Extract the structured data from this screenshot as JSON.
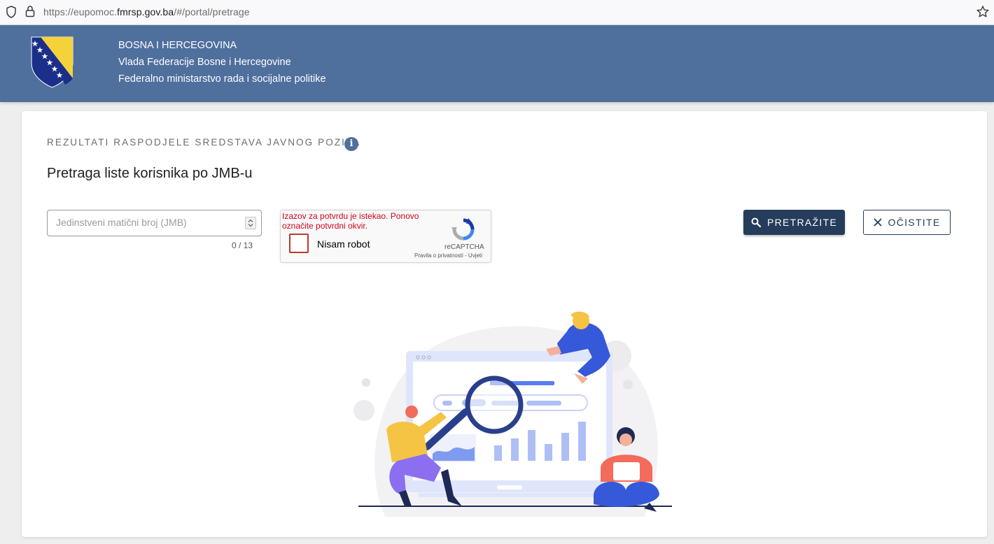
{
  "browser": {
    "url_prefix": "https://eupomoc.",
    "url_domain": "fmrsp.gov.ba",
    "url_path": "/#/portal/pretrage"
  },
  "header": {
    "line1": "BOSNA I HERCEGOVINA",
    "line2": "Vlada Federacije Bosne i Hercegovine",
    "line3": "Federalno ministarstvo rada i socijalne politike"
  },
  "card": {
    "overline": "REZULTATI RASPODJELE SREDSTAVA JAVNOG POZIVA",
    "info_icon_glyph": "i",
    "title": "Pretraga liste korisnika po JMB-u"
  },
  "form": {
    "jmb_placeholder": "Jedinstveni matični broj (JMB)",
    "jmb_value": "",
    "counter": "0 / 13",
    "search_label": "PRETRAŽITE",
    "clear_label": "OČISTITE"
  },
  "recaptcha": {
    "error": "Izazov za potvrdu je istekao. Ponovo označite potvrdni okvir.",
    "checkbox_label": "Nisam robot",
    "brand": "reCAPTCHA",
    "terms": "Pravila o privatnosti - Uvjeti"
  },
  "colors": {
    "header_bg": "#4f6f9d",
    "primary_button": "#253c5b",
    "error_text": "#d0021b"
  },
  "icons": {
    "search": "search-icon",
    "clear": "close-icon",
    "info": "info-icon"
  }
}
